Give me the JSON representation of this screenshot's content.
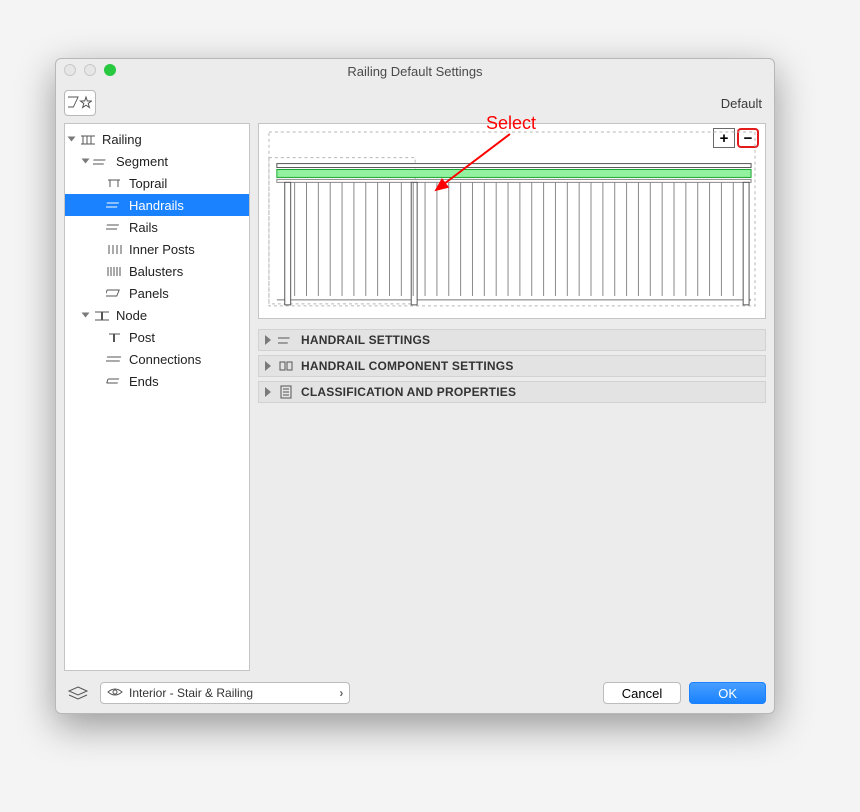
{
  "window": {
    "title": "Railing Default Settings",
    "default_label": "Default"
  },
  "annotation": {
    "label": "Select"
  },
  "tree": {
    "railing": "Railing",
    "segment": "Segment",
    "toprail": "Toprail",
    "handrails": "Handrails",
    "rails": "Rails",
    "inner_posts": "Inner Posts",
    "balusters": "Balusters",
    "panels": "Panels",
    "node": "Node",
    "post": "Post",
    "connections": "Connections",
    "ends": "Ends"
  },
  "pm": {
    "plus": "+",
    "minus": "−"
  },
  "sections": {
    "s1": "HANDRAIL SETTINGS",
    "s2": "HANDRAIL COMPONENT SETTINGS",
    "s3": "CLASSIFICATION AND PROPERTIES"
  },
  "footer": {
    "layer": "Interior - Stair & Railing",
    "cancel": "Cancel",
    "ok": "OK",
    "caret": "›"
  }
}
